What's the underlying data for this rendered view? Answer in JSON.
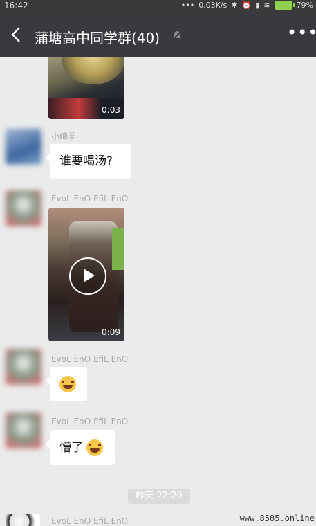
{
  "status_bar": {
    "time": "16:42",
    "dots": "•••",
    "speed": "0.03K/s",
    "battery": "79%"
  },
  "header": {
    "title": "蒲塘高中同学群(40)",
    "more": "•••"
  },
  "messages": [
    {
      "sender": "",
      "type": "video",
      "duration": "0:03"
    },
    {
      "sender": "小绵羊",
      "type": "text",
      "text": "谁要喝汤?"
    },
    {
      "sender": "EvoL EnO EfiL EnO",
      "type": "video",
      "duration": "0:09"
    },
    {
      "sender": "EvoL EnO EfiL EnO",
      "type": "emoji",
      "emoji": "laughing-tears"
    },
    {
      "sender": "EvoL EnO EfiL EnO",
      "type": "text",
      "text": "懵了",
      "emoji": "laughing-tears"
    },
    {
      "sender": "EvoL EnO EfiL EnO",
      "type": "partial"
    }
  ],
  "time_separator": "昨天 22:20",
  "watermark": "www.8585.online",
  "colors": {
    "header_bg": "#393a3f",
    "chat_bg": "#ebebeb",
    "bubble_bg": "#ffffff",
    "name_text": "#a9a9a9"
  }
}
